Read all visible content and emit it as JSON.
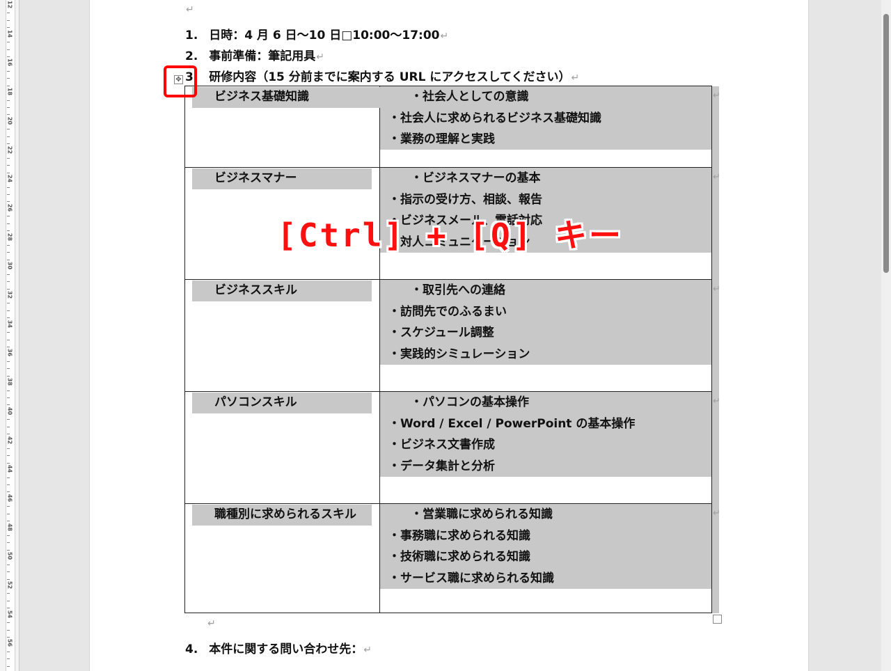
{
  "ruler": {
    "labels": [
      "12",
      "14",
      "16",
      "18",
      "20",
      "22",
      "24",
      "26",
      "28",
      "30",
      "32",
      "34",
      "36",
      "38",
      "40",
      "42",
      "44",
      "46",
      "48",
      "50",
      "52",
      "54",
      "56"
    ]
  },
  "paragraph_mark": "↵",
  "line_break_mark": "↓",
  "items": [
    {
      "num": "1.",
      "text": "日時：4 月 6 日〜10 日□10:00〜17:00"
    },
    {
      "num": "2.",
      "text": "事前準備：筆記用具"
    },
    {
      "num": "3.",
      "text": "研修内容（15 分前までに案内する URL にアクセスしてください）"
    }
  ],
  "table": {
    "rows": [
      {
        "left": "ビジネス基礎知識",
        "right": [
          "・社会人としての意識",
          "・社会人に求められるビジネス基礎知識",
          "・業務の理解と実践"
        ]
      },
      {
        "left": "ビジネスマナー",
        "right": [
          "・ビジネスマナーの基本",
          "・指示の受け方、相談、報告",
          "・ビジネスメール、電話対応",
          "・対人コミュニケーション"
        ]
      },
      {
        "left": "ビジネススキル",
        "right": [
          "・取引先への連絡",
          "・訪問先でのふるまい",
          "・スケジュール調整",
          "・実践的シミュレーション"
        ]
      },
      {
        "left": "パソコンスキル",
        "right": [
          "・パソコンの基本操作",
          "・Word / Excel / PowerPoint の基本操作",
          "・ビジネス文書作成",
          "・データ集計と分析"
        ]
      },
      {
        "left": "職種別に求められるスキル",
        "right": [
          "・営業職に求められる知識",
          "・事務職に求められる知識",
          "・技術職に求められる知識",
          "・サービス職に求められる知識"
        ]
      }
    ]
  },
  "item4": {
    "num": "4.",
    "text": "本件に関する問い合わせ先："
  },
  "overlay_text": "[Ctrl] + [Q] キー",
  "move_handle_icon": "move-arrows-icon",
  "colors": {
    "highlight": "#c8c8c8",
    "annotation": "#ff0000"
  }
}
